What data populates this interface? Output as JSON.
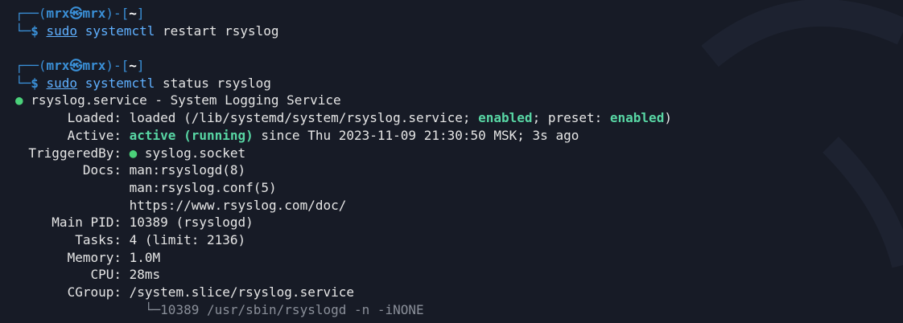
{
  "prompt1": {
    "user": "mrx",
    "at_symbol": "㉿",
    "host": "mrx",
    "dir": "~",
    "sudo": "sudo",
    "command": "systemctl",
    "args": "restart rsyslog"
  },
  "prompt2": {
    "user": "mrx",
    "at_symbol": "㉿",
    "host": "mrx",
    "dir": "~",
    "sudo": "sudo",
    "command": "systemctl",
    "args": "status rsyslog"
  },
  "status": {
    "bullet": "●",
    "unit_title": "rsyslog.service - System Logging Service",
    "loaded_label": "Loaded:",
    "loaded_prefix": "loaded (/lib/systemd/system/rsyslog.service; ",
    "loaded_enabled": "enabled",
    "loaded_mid": "; preset: ",
    "loaded_preset": "enabled",
    "loaded_suffix": ")",
    "active_label": "Active:",
    "active_state": "active (running)",
    "active_rest": " since Thu 2023-11-09 21:30:50 MSK; 3s ago",
    "triggered_label": "TriggeredBy:",
    "triggered_bullet": "●",
    "triggered_value": "syslog.socket",
    "docs_label": "Docs:",
    "docs": [
      "man:rsyslogd(8)",
      "man:rsyslog.conf(5)",
      "https://www.rsyslog.com/doc/"
    ],
    "pid_label": "Main PID:",
    "pid_value": "10389 (rsyslogd)",
    "tasks_label": "Tasks:",
    "tasks_value": "4 (limit: 2136)",
    "memory_label": "Memory:",
    "memory_value": "1.0M",
    "cpu_label": "CPU:",
    "cpu_value": "28ms",
    "cgroup_label": "CGroup:",
    "cgroup_value": "/system.slice/rsyslog.service",
    "cgroup_child_tree": "└─",
    "cgroup_child": "10389 /usr/sbin/rsyslogd -n -iNONE"
  }
}
